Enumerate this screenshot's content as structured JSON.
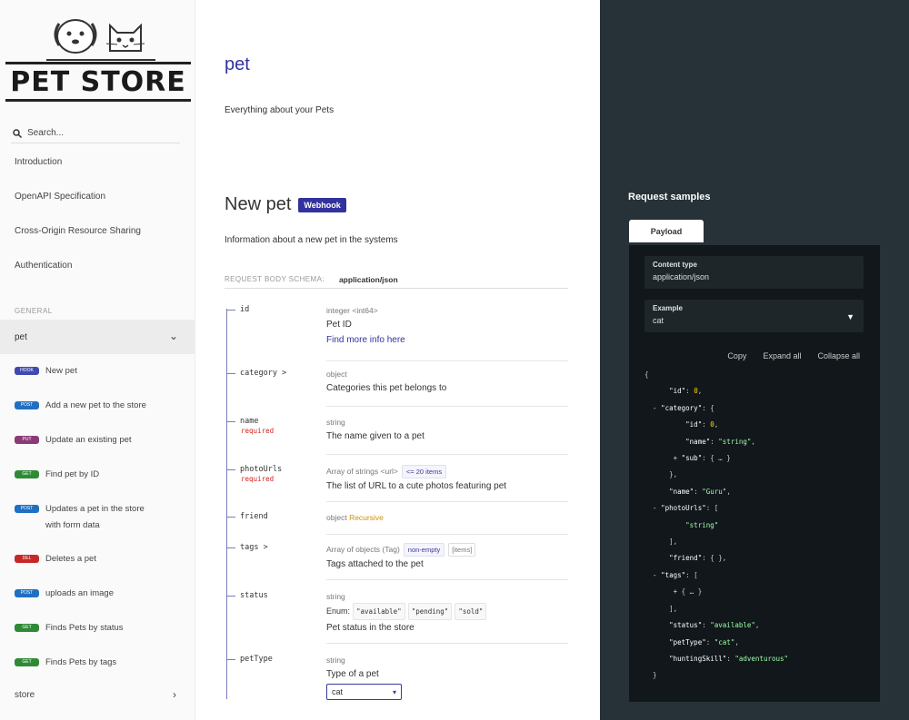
{
  "brand": {
    "logo_text": "PET STORE"
  },
  "sidebar": {
    "search_placeholder": "Search...",
    "top_items": [
      {
        "label": "Introduction"
      },
      {
        "label": "OpenAPI Specification"
      },
      {
        "label": "Cross-Origin Resource Sharing"
      },
      {
        "label": "Authentication"
      }
    ],
    "section_label": "GENERAL",
    "group_pet": "pet",
    "operations": [
      {
        "method": "HOOK",
        "label": "New pet"
      },
      {
        "method": "POST",
        "label": "Add a new pet to the store"
      },
      {
        "method": "PUT",
        "label": "Update an existing pet"
      },
      {
        "method": "GET",
        "label": "Find pet by ID"
      },
      {
        "method": "POST",
        "label": "Updates a pet in the store",
        "label2": "with form data"
      },
      {
        "method": "DEL",
        "label": "Deletes a pet"
      },
      {
        "method": "POST",
        "label": "uploads an image"
      },
      {
        "method": "GET",
        "label": "Finds Pets by status"
      },
      {
        "method": "GET",
        "label": "Finds Pets by tags"
      }
    ],
    "group_store": "store"
  },
  "main": {
    "tag_title": "pet",
    "tag_desc": "Everything about your Pets",
    "op_title": "New pet",
    "op_badge": "Webhook",
    "op_desc": "Information about a new pet in the systems",
    "request_body_label": "REQUEST BODY SCHEMA:",
    "content_type": "application/json",
    "params": [
      {
        "name": "id",
        "type": "integer <int64>",
        "desc": "Pet ID",
        "link": "Find more info here"
      },
      {
        "name": "category >",
        "type": "object",
        "desc": "Categories this pet belongs to"
      },
      {
        "name": "name",
        "required": "required",
        "type": "string",
        "desc": "The name given to a pet"
      },
      {
        "name": "photoUrls",
        "required": "required",
        "type": "Array of strings <url>",
        "chip": "<= 20 items",
        "desc": "The list of URL to a cute photos featuring pet"
      },
      {
        "name": "friend",
        "type": "object",
        "type_extra": "Recursive"
      },
      {
        "name": "tags >",
        "type": "Array of objects (Tag)",
        "chip": "non-empty",
        "chip2": "[items]",
        "desc": "Tags attached to the pet"
      },
      {
        "name": "status",
        "type": "string",
        "enum_label": "Enum:",
        "enums": [
          "\"available\"",
          "\"pending\"",
          "\"sold\""
        ],
        "desc": "Pet status in the store"
      },
      {
        "name": "petType",
        "type": "string",
        "desc": "Type of a pet",
        "select_value": "cat"
      }
    ]
  },
  "samples": {
    "title": "Request samples",
    "tab": "Payload",
    "content_type_label": "Content type",
    "content_type_value": "application/json",
    "example_label": "Example",
    "example_value": "cat",
    "actions": [
      "Copy",
      "Expand all",
      "Collapse all"
    ],
    "code": {
      "l1": "{",
      "id_key": "\"id\"",
      "id_val": "0",
      "category_key": "\"category\"",
      "c_id_key": "\"id\"",
      "c_id_val": "0",
      "c_name_key": "\"name\"",
      "c_name_val": "\"string\"",
      "c_sub_key": "\"sub\"",
      "name_key": "\"name\"",
      "name_val": "\"Guru\"",
      "photo_key": "\"photoUrls\"",
      "photo_val": "\"string\"",
      "friend_key": "\"friend\"",
      "tags_key": "\"tags\"",
      "status_key": "\"status\"",
      "status_val": "\"available\"",
      "pettype_key": "\"petType\"",
      "pettype_val": "\"cat\"",
      "hunt_key": "\"huntingSkill\"",
      "hunt_val": "\"adventurous\"",
      "close": "}"
    }
  }
}
